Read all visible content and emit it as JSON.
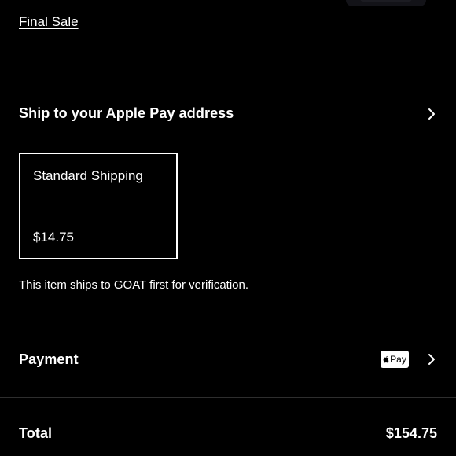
{
  "final_sale_label": "Final Sale",
  "shipping": {
    "address_label": "Ship to your Apple Pay address",
    "option": {
      "name": "Standard Shipping",
      "price": "$14.75"
    },
    "note": "This item ships to GOAT first for verification."
  },
  "payment": {
    "label": "Payment",
    "method_badge": "Pay"
  },
  "total": {
    "label": "Total",
    "amount": "$154.75"
  },
  "icons": {
    "chevron": "chevron-right-icon",
    "apple_pay": "apple-pay-icon"
  }
}
